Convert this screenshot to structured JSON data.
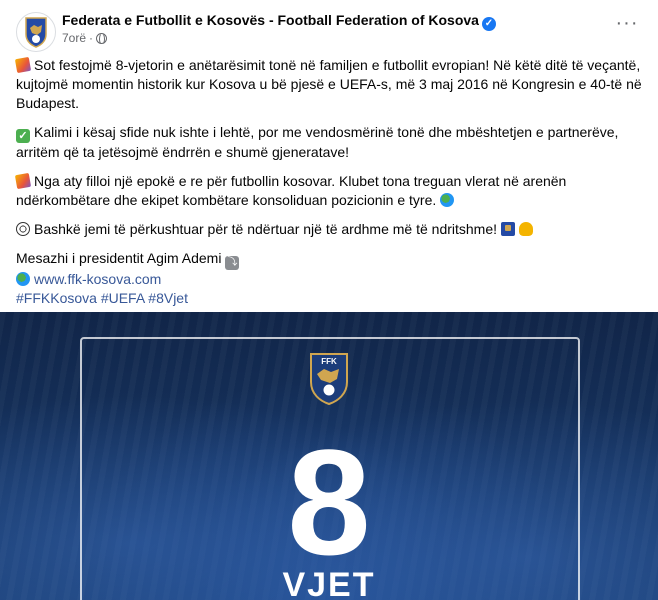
{
  "header": {
    "page_name": "Federata e Futbollit e Kosovës - Football Federation of Kosova",
    "time": "7orë",
    "dot": "·",
    "verified_icon": "verified-badge-icon",
    "privacy_icon": "globe-icon",
    "more_label": "···"
  },
  "post": {
    "paragraphs": [
      {
        "emoji": "party-popper-icon",
        "text": "Sot festojmë 8-vjetorin e anëtarësimit tonë në familjen e futbollit evropian! Në këtë ditë të veçantë, kujtojmë momentin historik kur Kosova u bë pjesë e UEFA-s, më 3 maj 2016 në Kongresin e 40-të në Budapest."
      },
      {
        "emoji": "check-mark-icon",
        "text": "Kalimi i kësaj sfide nuk ishte i lehtë, por me vendosmërinë tonë dhe mbështetjen e partnerëve, arritëm që ta jetësojmë ëndrrën e shumë gjeneratave!"
      },
      {
        "emoji": "party-popper-icon",
        "text": "Nga aty filloi një epokë e re për futbollin kosovar. Klubet tona treguan vlerat në arenën ndërkombëtare dhe ekipet kombëtare konsoliduan pozicionin e tyre."
      },
      {
        "emoji": "soccer-ball-icon",
        "text": "Bashkë jemi të përkushtuar për të ndërtuar një të ardhme më të ndritshme!"
      }
    ],
    "closing": "Mesazhi i presidentit Agim Ademi",
    "website": "www.ffk-kosova.com",
    "hashtags": "#FFKKosova #UEFA #8Vjet"
  },
  "image": {
    "logo_text": "FFK",
    "number": "8",
    "label": "VJET"
  },
  "colors": {
    "link": "#385898",
    "verified": "#1877f2",
    "image_bg": "#13294f"
  }
}
